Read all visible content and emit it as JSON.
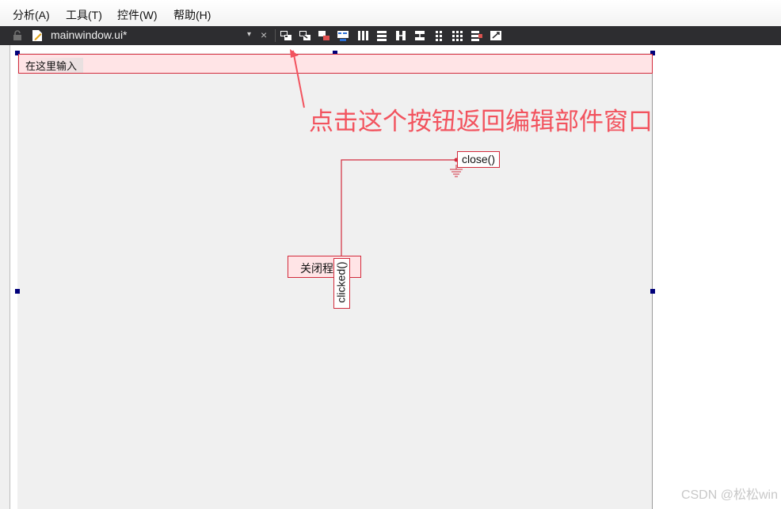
{
  "menu": {
    "items": [
      "分析(A)",
      "工具(T)",
      "控件(W)",
      "帮助(H)"
    ]
  },
  "toolbar": {
    "file_name": "mainwindow.ui*",
    "close_glyph": "×",
    "buttons": [
      "edit-widgets-icon",
      "edit-signals-slots-icon",
      "edit-buddies-icon",
      "edit-tab-order-icon",
      "layout-horizontal-icon",
      "layout-vertical-icon",
      "layout-horizontal-splitter-icon",
      "layout-vertical-splitter-icon",
      "layout-form-icon",
      "layout-grid-icon",
      "break-layout-icon",
      "adjust-size-icon"
    ]
  },
  "form": {
    "line_edit_text": "在这里输入",
    "push_button_text": "关闭程序",
    "signal": "clicked()",
    "slot": "close()"
  },
  "annotation": {
    "text": "点击这个按钮返回编辑部件窗口",
    "color": "#f2535e"
  },
  "watermark": "CSDN @松松win",
  "colors": {
    "toolbar_bg": "#2d2d30",
    "connection": "#d22b3c",
    "selection_handle": "#00007a",
    "canvas": "#f0f0f0"
  }
}
